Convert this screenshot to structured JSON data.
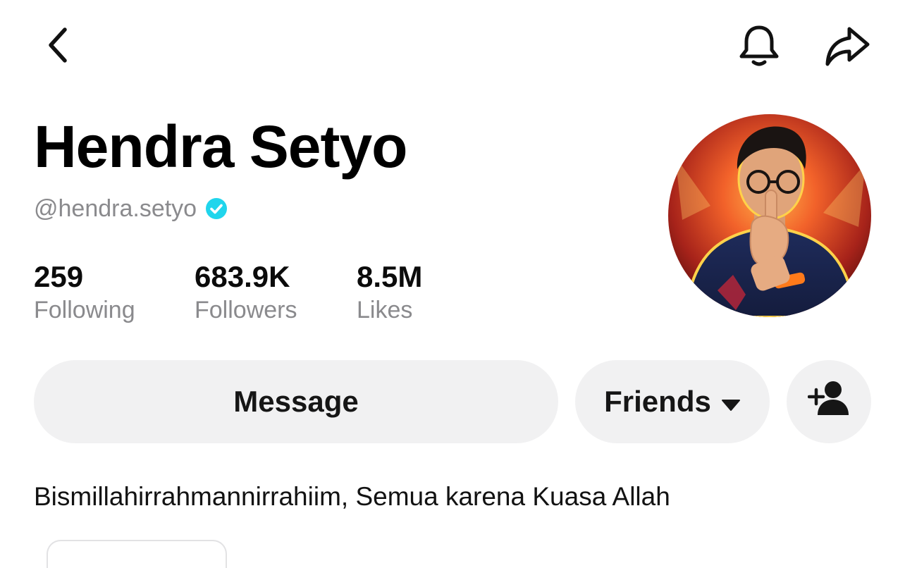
{
  "header": {
    "back_icon": "chevron-left-icon",
    "notification_icon": "bell-icon",
    "share_icon": "share-arrow-icon"
  },
  "profile": {
    "display_name": "Hendra Setyo",
    "handle": "@hendra.setyo",
    "verified": true,
    "verified_color": "#20d5ec",
    "avatar_icon": "profile-photo"
  },
  "stats": [
    {
      "value": "259",
      "label": "Following"
    },
    {
      "value": "683.9K",
      "label": "Followers"
    },
    {
      "value": "8.5M",
      "label": "Likes"
    }
  ],
  "actions": {
    "message_label": "Message",
    "friends_label": "Friends",
    "friends_icon": "caret-down-icon",
    "add_friend_icon": "add-user-icon"
  },
  "bio": "Bismillahirrahmannirrahiim, Semua karena Kuasa Allah",
  "colors": {
    "primary_text": "#111111",
    "secondary_text": "#8a8a8d",
    "button_bg": "#f1f1f2",
    "background": "#ffffff"
  }
}
